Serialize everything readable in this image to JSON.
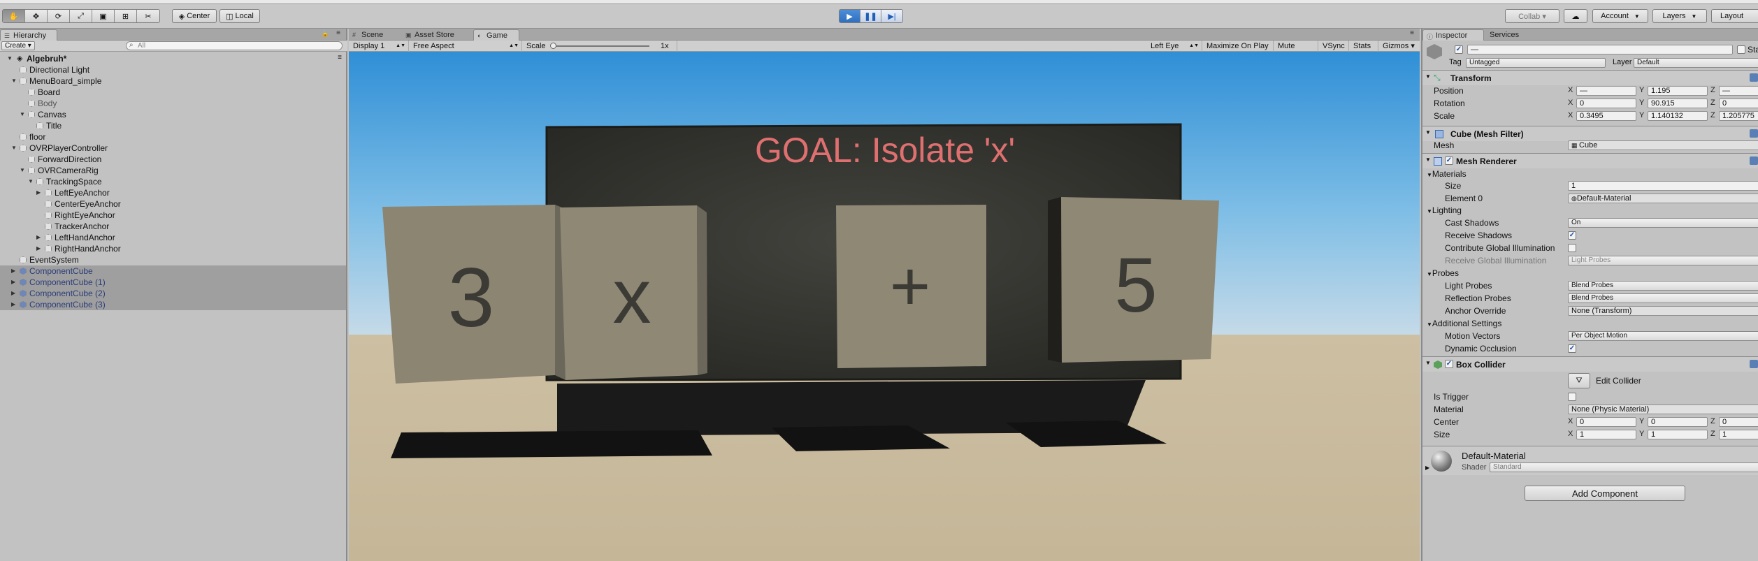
{
  "toolbar": {
    "pivot_label": "Center",
    "space_label": "Local",
    "collab_label": "Collab ▾",
    "account_label": "Account",
    "layers_label": "Layers",
    "layout_label": "Layout"
  },
  "hierarchy": {
    "tab_label": "Hierarchy",
    "create_label": "Create ▾",
    "search_placeholder": "All",
    "scene_name": "Algebruh*",
    "items": [
      {
        "label": "Directional Light",
        "depth": 1,
        "arrow": "",
        "style": "normal"
      },
      {
        "label": "MenuBoard_simple",
        "depth": 1,
        "arrow": "down",
        "style": "normal"
      },
      {
        "label": "Board",
        "depth": 2,
        "arrow": "",
        "style": "normal"
      },
      {
        "label": "Body",
        "depth": 2,
        "arrow": "",
        "style": "dim"
      },
      {
        "label": "Canvas",
        "depth": 2,
        "arrow": "down",
        "style": "normal"
      },
      {
        "label": "Title",
        "depth": 3,
        "arrow": "",
        "style": "normal"
      },
      {
        "label": "floor",
        "depth": 1,
        "arrow": "",
        "style": "normal"
      },
      {
        "label": "OVRPlayerController",
        "depth": 1,
        "arrow": "down",
        "style": "normal"
      },
      {
        "label": "ForwardDirection",
        "depth": 2,
        "arrow": "",
        "style": "normal"
      },
      {
        "label": "OVRCameraRig",
        "depth": 2,
        "arrow": "down",
        "style": "normal"
      },
      {
        "label": "TrackingSpace",
        "depth": 3,
        "arrow": "down",
        "style": "normal"
      },
      {
        "label": "LeftEyeAnchor",
        "depth": 4,
        "arrow": "right",
        "style": "normal"
      },
      {
        "label": "CenterEyeAnchor",
        "depth": 4,
        "arrow": "",
        "style": "normal"
      },
      {
        "label": "RightEyeAnchor",
        "depth": 4,
        "arrow": "",
        "style": "normal"
      },
      {
        "label": "TrackerAnchor",
        "depth": 4,
        "arrow": "",
        "style": "normal"
      },
      {
        "label": "LeftHandAnchor",
        "depth": 4,
        "arrow": "right",
        "style": "normal"
      },
      {
        "label": "RightHandAnchor",
        "depth": 4,
        "arrow": "right",
        "style": "normal"
      },
      {
        "label": "EventSystem",
        "depth": 1,
        "arrow": "",
        "style": "normal"
      },
      {
        "label": "ComponentCube",
        "depth": 1,
        "arrow": "right",
        "style": "prefab"
      },
      {
        "label": "ComponentCube (1)",
        "depth": 1,
        "arrow": "right",
        "style": "prefab"
      },
      {
        "label": "ComponentCube (2)",
        "depth": 1,
        "arrow": "right",
        "style": "prefab"
      },
      {
        "label": "ComponentCube (3)",
        "depth": 1,
        "arrow": "right",
        "style": "prefab"
      }
    ]
  },
  "game": {
    "tabs": [
      {
        "label": "Scene",
        "icon": "#"
      },
      {
        "label": "Asset Store",
        "icon": "▣"
      },
      {
        "label": "Game",
        "icon": "◐"
      }
    ],
    "display": "Display 1",
    "aspect": "Free Aspect",
    "scale_label": "Scale",
    "scale_value": "1x",
    "eye": "Left Eye",
    "maximize": "Maximize On Play",
    "mute": "Mute Audio",
    "vsync": "VSync",
    "stats": "Stats",
    "gizmos": "Gizmos ▾",
    "goal_text": "GOAL: Isolate 'x'",
    "cubes": [
      "3",
      "x",
      "+",
      "5"
    ]
  },
  "inspector": {
    "tabs": [
      "Inspector",
      "Services"
    ],
    "name_value": "—",
    "static_label": "Static",
    "tag_label": "Tag",
    "tag_value": "Untagged",
    "layer_label": "Layer",
    "layer_value": "Default",
    "transform": {
      "title": "Transform",
      "position_label": "Position",
      "rotation_label": "Rotation",
      "scale_label": "Scale",
      "position": [
        "—",
        "1.195",
        "—"
      ],
      "rotation": [
        "0",
        "90.915",
        "0"
      ],
      "scale": [
        "0.3495",
        "1.140132",
        "1.205775"
      ]
    },
    "mesh_filter": {
      "title": "Cube (Mesh Filter)",
      "mesh_label": "Mesh",
      "mesh_value": "Cube"
    },
    "mesh_renderer": {
      "title": "Mesh Renderer",
      "materials": "Materials",
      "size_label": "Size",
      "size_value": "1",
      "element0_label": "Element 0",
      "element0_value": "Default-Material",
      "lighting": "Lighting",
      "cast_shadows_label": "Cast Shadows",
      "cast_shadows_value": "On",
      "receive_shadows_label": "Receive Shadows",
      "cgi_label": "Contribute Global Illumination",
      "rgi_label": "Receive Global Illumination",
      "rgi_value": "Light Probes",
      "probes": "Probes",
      "light_probes_label": "Light Probes",
      "light_probes_value": "Blend Probes",
      "reflection_probes_label": "Reflection Probes",
      "reflection_probes_value": "Blend Probes",
      "anchor_label": "Anchor Override",
      "anchor_value": "None (Transform)",
      "additional": "Additional Settings",
      "motion_label": "Motion Vectors",
      "motion_value": "Per Object Motion",
      "dynocc_label": "Dynamic Occlusion"
    },
    "box_collider": {
      "title": "Box Collider",
      "edit_label": "Edit Collider",
      "trigger_label": "Is Trigger",
      "material_label": "Material",
      "material_value": "None (Physic Material)",
      "center_label": "Center",
      "size_label": "Size",
      "center": [
        "0",
        "0",
        "0"
      ],
      "size": [
        "1",
        "1",
        "1"
      ]
    },
    "material": {
      "name": "Default-Material",
      "shader_label": "Shader",
      "shader_value": "Standard"
    },
    "add_component": "Add Component"
  }
}
